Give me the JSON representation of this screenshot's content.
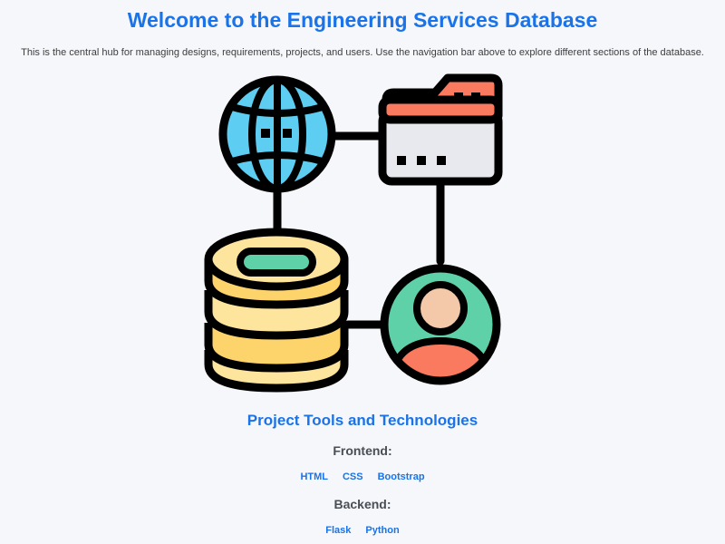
{
  "header": {
    "title": "Welcome to the Engineering Services Database",
    "intro": "This is the central hub for managing designs, requirements, projects, and users. Use the navigation bar above to explore different sections of the database."
  },
  "illustration": {
    "icons": [
      "globe-icon",
      "browser-window-icon",
      "database-icon",
      "user-icon"
    ],
    "colors": {
      "globe": "#5ecdf2",
      "folder_tab": "#fa7a5f",
      "window_body": "#e8e9ee",
      "database": "#fde59e",
      "database_shade": "#fdd36b",
      "database_slot": "#5fd1a9",
      "user_bg": "#5fd1a9",
      "user_head": "#f3c9a9",
      "user_body": "#fa7a5f",
      "outline": "#000000"
    }
  },
  "tools": {
    "title": "Project Tools and Technologies",
    "frontend": {
      "label": "Frontend:",
      "items": [
        "HTML",
        "CSS",
        "Bootstrap"
      ]
    },
    "backend": {
      "label": "Backend:",
      "items": [
        "Flask",
        "Python"
      ]
    }
  },
  "colors": {
    "accent": "#1a73e8",
    "background": "#f5f7fa",
    "text": "#3d3d3d"
  }
}
